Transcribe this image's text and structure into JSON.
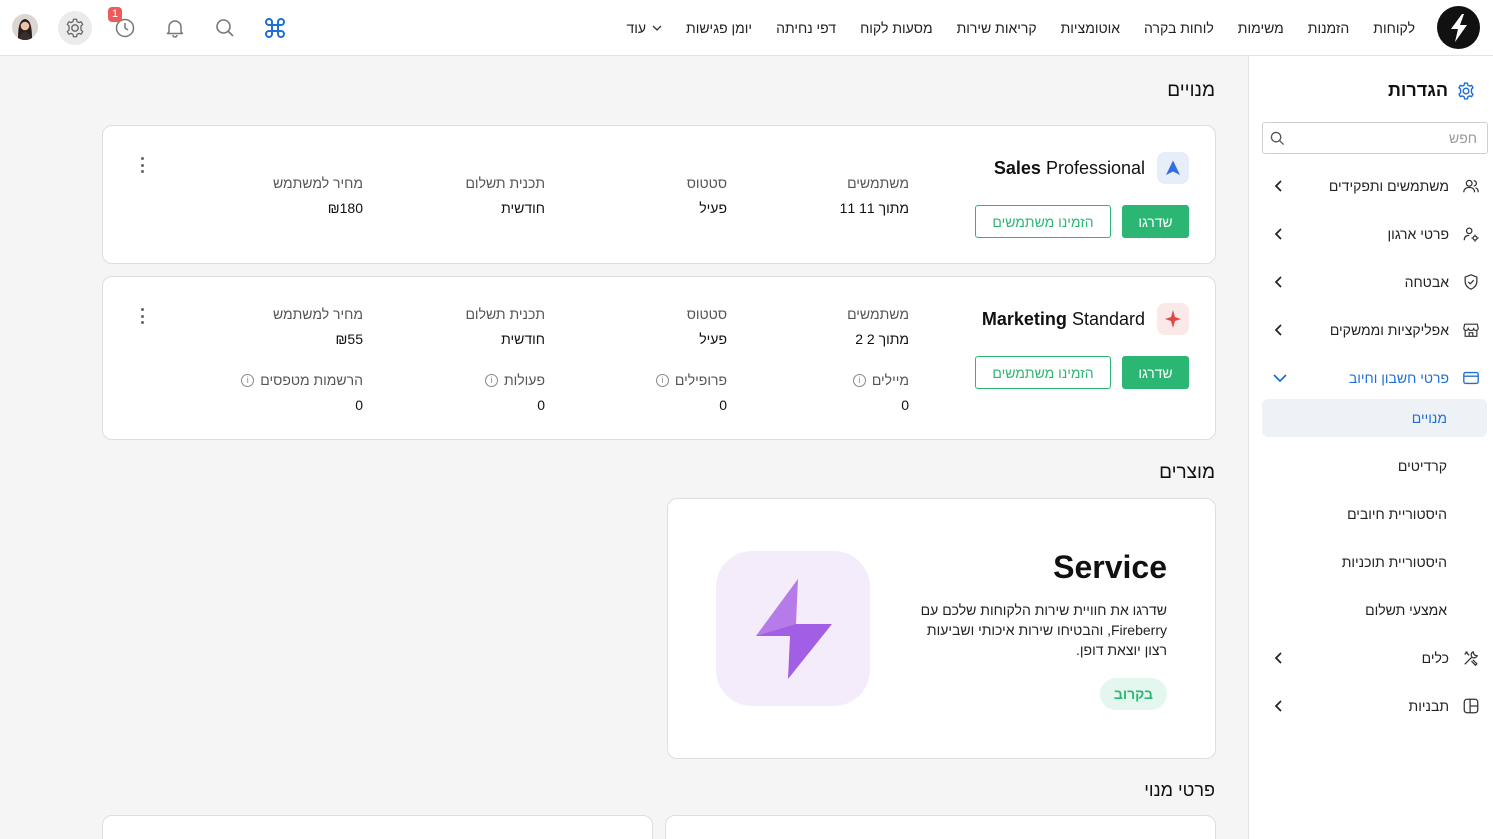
{
  "nav": {
    "items": [
      "לקוחות",
      "הזמנות",
      "משימות",
      "לוחות בקרה",
      "אוטומציות",
      "קריאות שירות",
      "מסעות לקוח",
      "דפי נחיתה",
      "יומן פגישות"
    ],
    "more_label": "עוד",
    "notification_count": "1"
  },
  "sidebar": {
    "title": "הגדרות",
    "search_placeholder": "חפש",
    "sections": [
      {
        "label": "משתמשים ותפקידים",
        "icon": "users-icon"
      },
      {
        "label": "פרטי ארגון",
        "icon": "org-settings-icon"
      },
      {
        "label": "אבטחה",
        "icon": "shield-icon"
      },
      {
        "label": "אפליקציות וממשקים",
        "icon": "store-icon"
      },
      {
        "label": "פרטי חשבון וחיוב",
        "icon": "credit-card-icon"
      }
    ],
    "billing_sub": [
      "מנויים",
      "קרדיטים",
      "היסטוריית חיובים",
      "היסטוריית תוכניות",
      "אמצעי תשלום"
    ],
    "tools": {
      "label": "כלים",
      "icon": "tools-icon"
    },
    "templates": {
      "label": "תבניות",
      "icon": "templates-icon"
    }
  },
  "subscriptions": {
    "title": "מנויים",
    "plans": [
      {
        "name_bold": "Sales",
        "name_rest": "Professional",
        "upgrade_label": "שדרגו",
        "invite_label": "הזמינו משתמשים",
        "users_label": "משתמשים",
        "users_value": "11 מתוך 11",
        "status_label": "סטטוס",
        "status_value": "פעיל",
        "plan_label": "תכנית תשלום",
        "plan_value": "חודשית",
        "price_label": "מחיר למשתמש",
        "price_value": "₪180"
      },
      {
        "name_bold": "Marketing",
        "name_rest": "Standard",
        "upgrade_label": "שדרגו",
        "invite_label": "הזמינו משתמשים",
        "users_label": "משתמשים",
        "users_value": "2 מתוך 2",
        "status_label": "סטטוס",
        "status_value": "פעיל",
        "plan_label": "תכנית תשלום",
        "plan_value": "חודשית",
        "price_label": "מחיר למשתמש",
        "price_value": "₪55",
        "emails_label": "מיילים",
        "emails_value": "0",
        "profiles_label": "פרופילים",
        "profiles_value": "0",
        "actions_label": "פעולות",
        "actions_value": "0",
        "forms_label": "הרשמות מטפסים",
        "forms_value": "0"
      }
    ]
  },
  "products": {
    "title": "מוצרים",
    "service": {
      "name": "Service",
      "description": "שדרגו את חוויית שירות הלקוחות שלכם עם Fireberry, והבטיחו שירות איכותי ושביעות רצון יוצאת דופן.",
      "badge": "בקרוב"
    }
  },
  "subscription_details": {
    "title": "פרטי מנוי"
  },
  "colors": {
    "accent_green": "#2bb673",
    "link_blue": "#1f6fd6",
    "badge_red": "#ef5a5a",
    "bolt_purple": "#a35ee6"
  }
}
